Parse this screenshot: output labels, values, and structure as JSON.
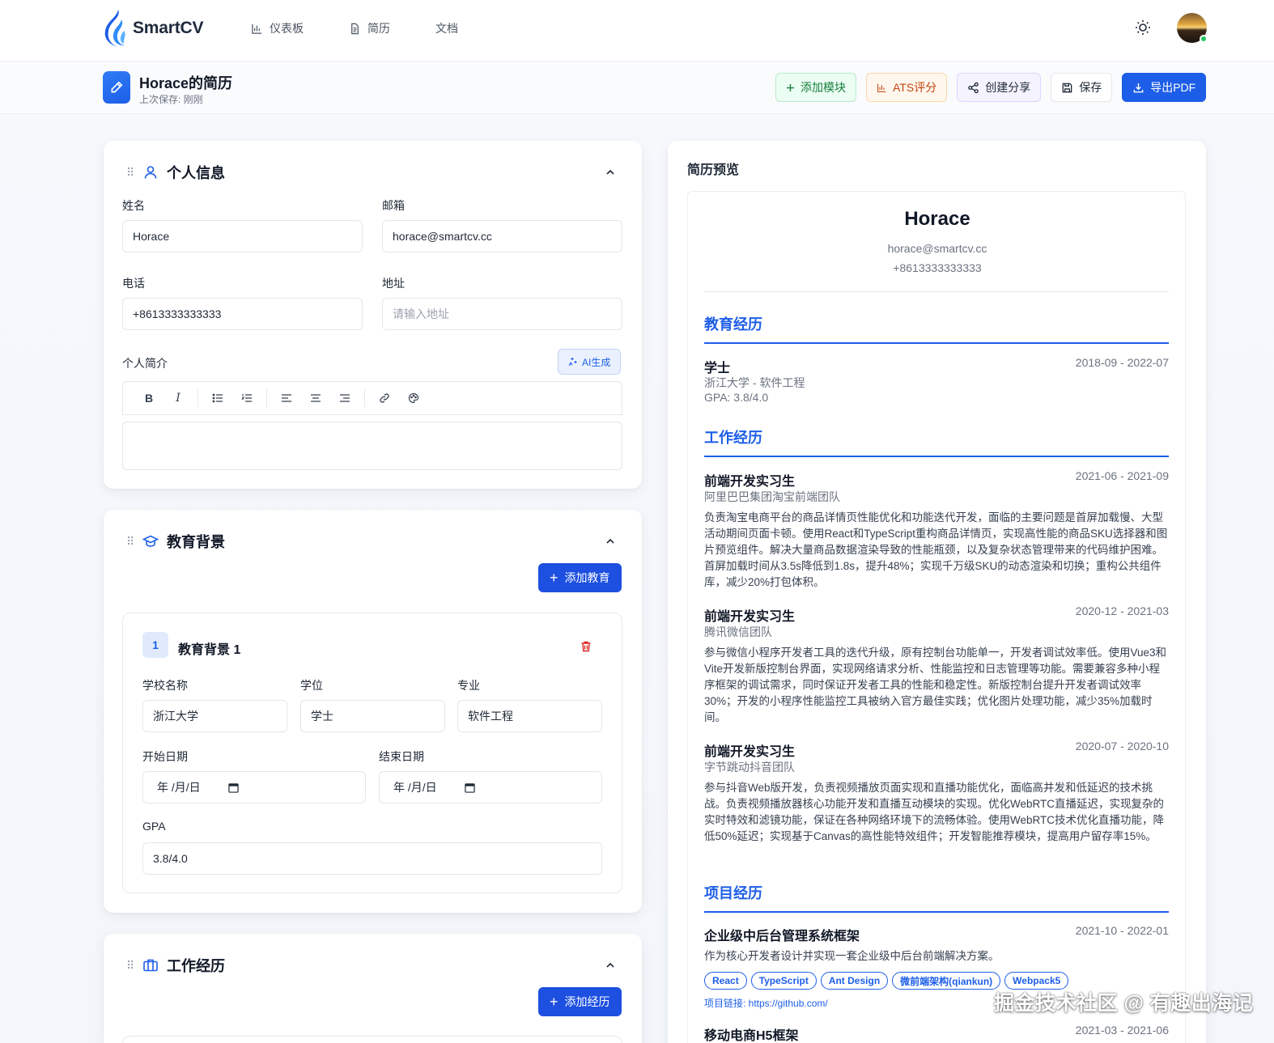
{
  "brand": {
    "name": "SmartCV"
  },
  "nav": {
    "items": [
      {
        "label": "仪表板",
        "icon": "bar-chart-icon"
      },
      {
        "label": "简历",
        "icon": "document-icon"
      },
      {
        "label": "文档",
        "icon": ""
      }
    ]
  },
  "header": {
    "title": "Horace的简历",
    "subtitle": "上次保存: 刚刚",
    "actions": {
      "add_module": "添加模块",
      "ats": "ATS评分",
      "share": "创建分享",
      "save": "保存",
      "export": "导出PDF"
    }
  },
  "personal": {
    "title": "个人信息",
    "name_label": "姓名",
    "name_value": "Horace",
    "email_label": "邮箱",
    "email_value": "horace@smartcv.cc",
    "phone_label": "电话",
    "phone_value": "+8613333333333",
    "address_label": "地址",
    "address_placeholder": "请输入地址",
    "summary_label": "个人简介",
    "ai_button": "AI生成",
    "toolbar": {
      "bold": "B",
      "italic": "I"
    }
  },
  "education": {
    "title": "教育背景",
    "add_button": "添加教育",
    "entry": {
      "index": "1",
      "title": "教育背景 1",
      "school_label": "学校名称",
      "school_value": "浙江大学",
      "degree_label": "学位",
      "degree_value": "学士",
      "major_label": "专业",
      "major_value": "软件工程",
      "start_label": "开始日期",
      "start_value": "年 /月/日",
      "end_label": "结束日期",
      "end_value": "年 /月/日",
      "gpa_label": "GPA",
      "gpa_value": "3.8/4.0"
    }
  },
  "work": {
    "title": "工作经历",
    "add_button": "添加经历"
  },
  "preview": {
    "title": "简历预览",
    "name": "Horace",
    "email": "horace@smartcv.cc",
    "phone": "+8613333333333",
    "education_heading": "教育经历",
    "edu": {
      "degree": "学士",
      "date": "2018-09 - 2022-07",
      "school": "浙江大学 - 软件工程",
      "gpa": "GPA: 3.8/4.0"
    },
    "work_heading": "工作经历",
    "jobs": [
      {
        "title": "前端开发实习生",
        "date": "2021-06 - 2021-09",
        "org": "阿里巴巴集团淘宝前端团队",
        "desc": "负责淘宝电商平台的商品详情页性能优化和功能迭代开发，面临的主要问题是首屏加载慢、大型活动期间页面卡顿。使用React和TypeScript重构商品详情页，实现高性能的商品SKU选择器和图片预览组件。解决大量商品数据渲染导致的性能瓶颈，以及复杂状态管理带来的代码维护困难。首屏加载时间从3.5s降低到1.8s，提升48%；实现千万级SKU的动态渲染和切换；重构公共组件库，减少20%打包体积。"
      },
      {
        "title": "前端开发实习生",
        "date": "2020-12 - 2021-03",
        "org": "腾讯微信团队",
        "desc": "参与微信小程序开发者工具的迭代升级，原有控制台功能单一，开发者调试效率低。使用Vue3和Vite开发新版控制台界面，实现网络请求分析、性能监控和日志管理等功能。需要兼容多种小程序框架的调试需求，同时保证开发者工具的性能和稳定性。新版控制台提升开发者调试效率30%；开发的小程序性能监控工具被纳入官方最佳实践；优化图片处理功能，减少35%加载时间。"
      },
      {
        "title": "前端开发实习生",
        "date": "2020-07 - 2020-10",
        "org": "字节跳动抖音团队",
        "desc": "参与抖音Web版开发，负责视频播放页面实现和直播功能优化，面临高并发和低延迟的技术挑战。负责视频播放器核心功能开发和直播互动模块的实现。优化WebRTC直播延迟，实现复杂的实时特效和滤镜功能，保证在各种网络环境下的流畅体验。使用WebRTC技术优化直播功能，降低50%延迟；实现基于Canvas的高性能特效组件；开发智能推荐模块，提高用户留存率15%。"
      }
    ],
    "project_heading": "项目经历",
    "projects": [
      {
        "title": "企业级中后台管理系统框架",
        "date": "2021-10 - 2022-01",
        "desc": "作为核心开发者设计并实现一套企业级中后台前端解决方案。",
        "tags": [
          "React",
          "TypeScript",
          "Ant Design",
          "微前端架构(qiankun)",
          "Webpack5"
        ],
        "link": "项目链接: https://github.com/"
      },
      {
        "title": "移动电商H5框架",
        "date": "2021-03 - 2021-06"
      }
    ]
  },
  "watermark": "掘金技术社区 @ 有趣出海记",
  "colors": {
    "primary": "#1d5ee8",
    "green": "#15803d",
    "amber": "#c2410c"
  }
}
